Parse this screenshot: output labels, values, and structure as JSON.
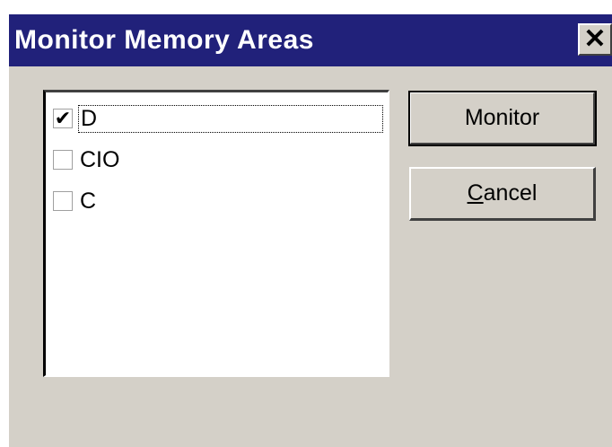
{
  "window": {
    "title": "Monitor Memory Areas"
  },
  "title_bar": {
    "close_glyph": "✕"
  },
  "memory_areas": [
    {
      "label": "D",
      "checked": true,
      "focused": true
    },
    {
      "label": "CIO",
      "checked": false,
      "focused": false
    },
    {
      "label": "C",
      "checked": false,
      "focused": false
    }
  ],
  "buttons": {
    "monitor_label": "Monitor",
    "cancel_label": "Cancel"
  },
  "colors": {
    "titlebar": "#21217a",
    "dialog_face": "#d4d0c8",
    "listbox": "#ffffff"
  }
}
